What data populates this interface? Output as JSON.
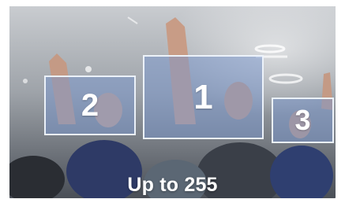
{
  "detections": [
    {
      "label": "1"
    },
    {
      "label": "2"
    },
    {
      "label": "3"
    }
  ],
  "caption": "Up to 255",
  "colors": {
    "box_fill": "#7896cd",
    "box_border": "#f0f5fc",
    "text": "#ffffff"
  }
}
